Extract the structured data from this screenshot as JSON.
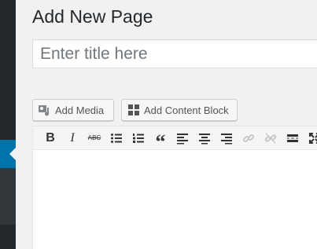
{
  "page": {
    "title": "Add New Page"
  },
  "title_field": {
    "placeholder": "Enter title here",
    "value": ""
  },
  "buttons": {
    "add_media": "Add Media",
    "add_content_block": "Add Content Block"
  },
  "toolbar": {
    "items": [
      {
        "name": "bold",
        "icon": "bold-icon",
        "glyph": "B"
      },
      {
        "name": "italic",
        "icon": "italic-icon",
        "glyph": "I"
      },
      {
        "name": "strikethrough",
        "icon": "strikethrough-icon",
        "glyph": "ABC"
      },
      {
        "name": "bulleted-list",
        "icon": "bulleted-list-icon"
      },
      {
        "name": "numbered-list",
        "icon": "numbered-list-icon"
      },
      {
        "name": "blockquote",
        "icon": "blockquote-icon",
        "glyph": "“"
      },
      {
        "name": "align-left",
        "icon": "align-left-icon"
      },
      {
        "name": "align-center",
        "icon": "align-center-icon"
      },
      {
        "name": "align-right",
        "icon": "align-right-icon"
      },
      {
        "name": "insert-link",
        "icon": "link-icon"
      },
      {
        "name": "remove-link",
        "icon": "unlink-icon"
      },
      {
        "name": "read-more",
        "icon": "read-more-icon"
      },
      {
        "name": "fullscreen",
        "icon": "fullscreen-icon"
      }
    ]
  },
  "colors": {
    "sidebar": "#23282d",
    "sidebar_active": "#0073aa",
    "background": "#f1f1f1"
  }
}
